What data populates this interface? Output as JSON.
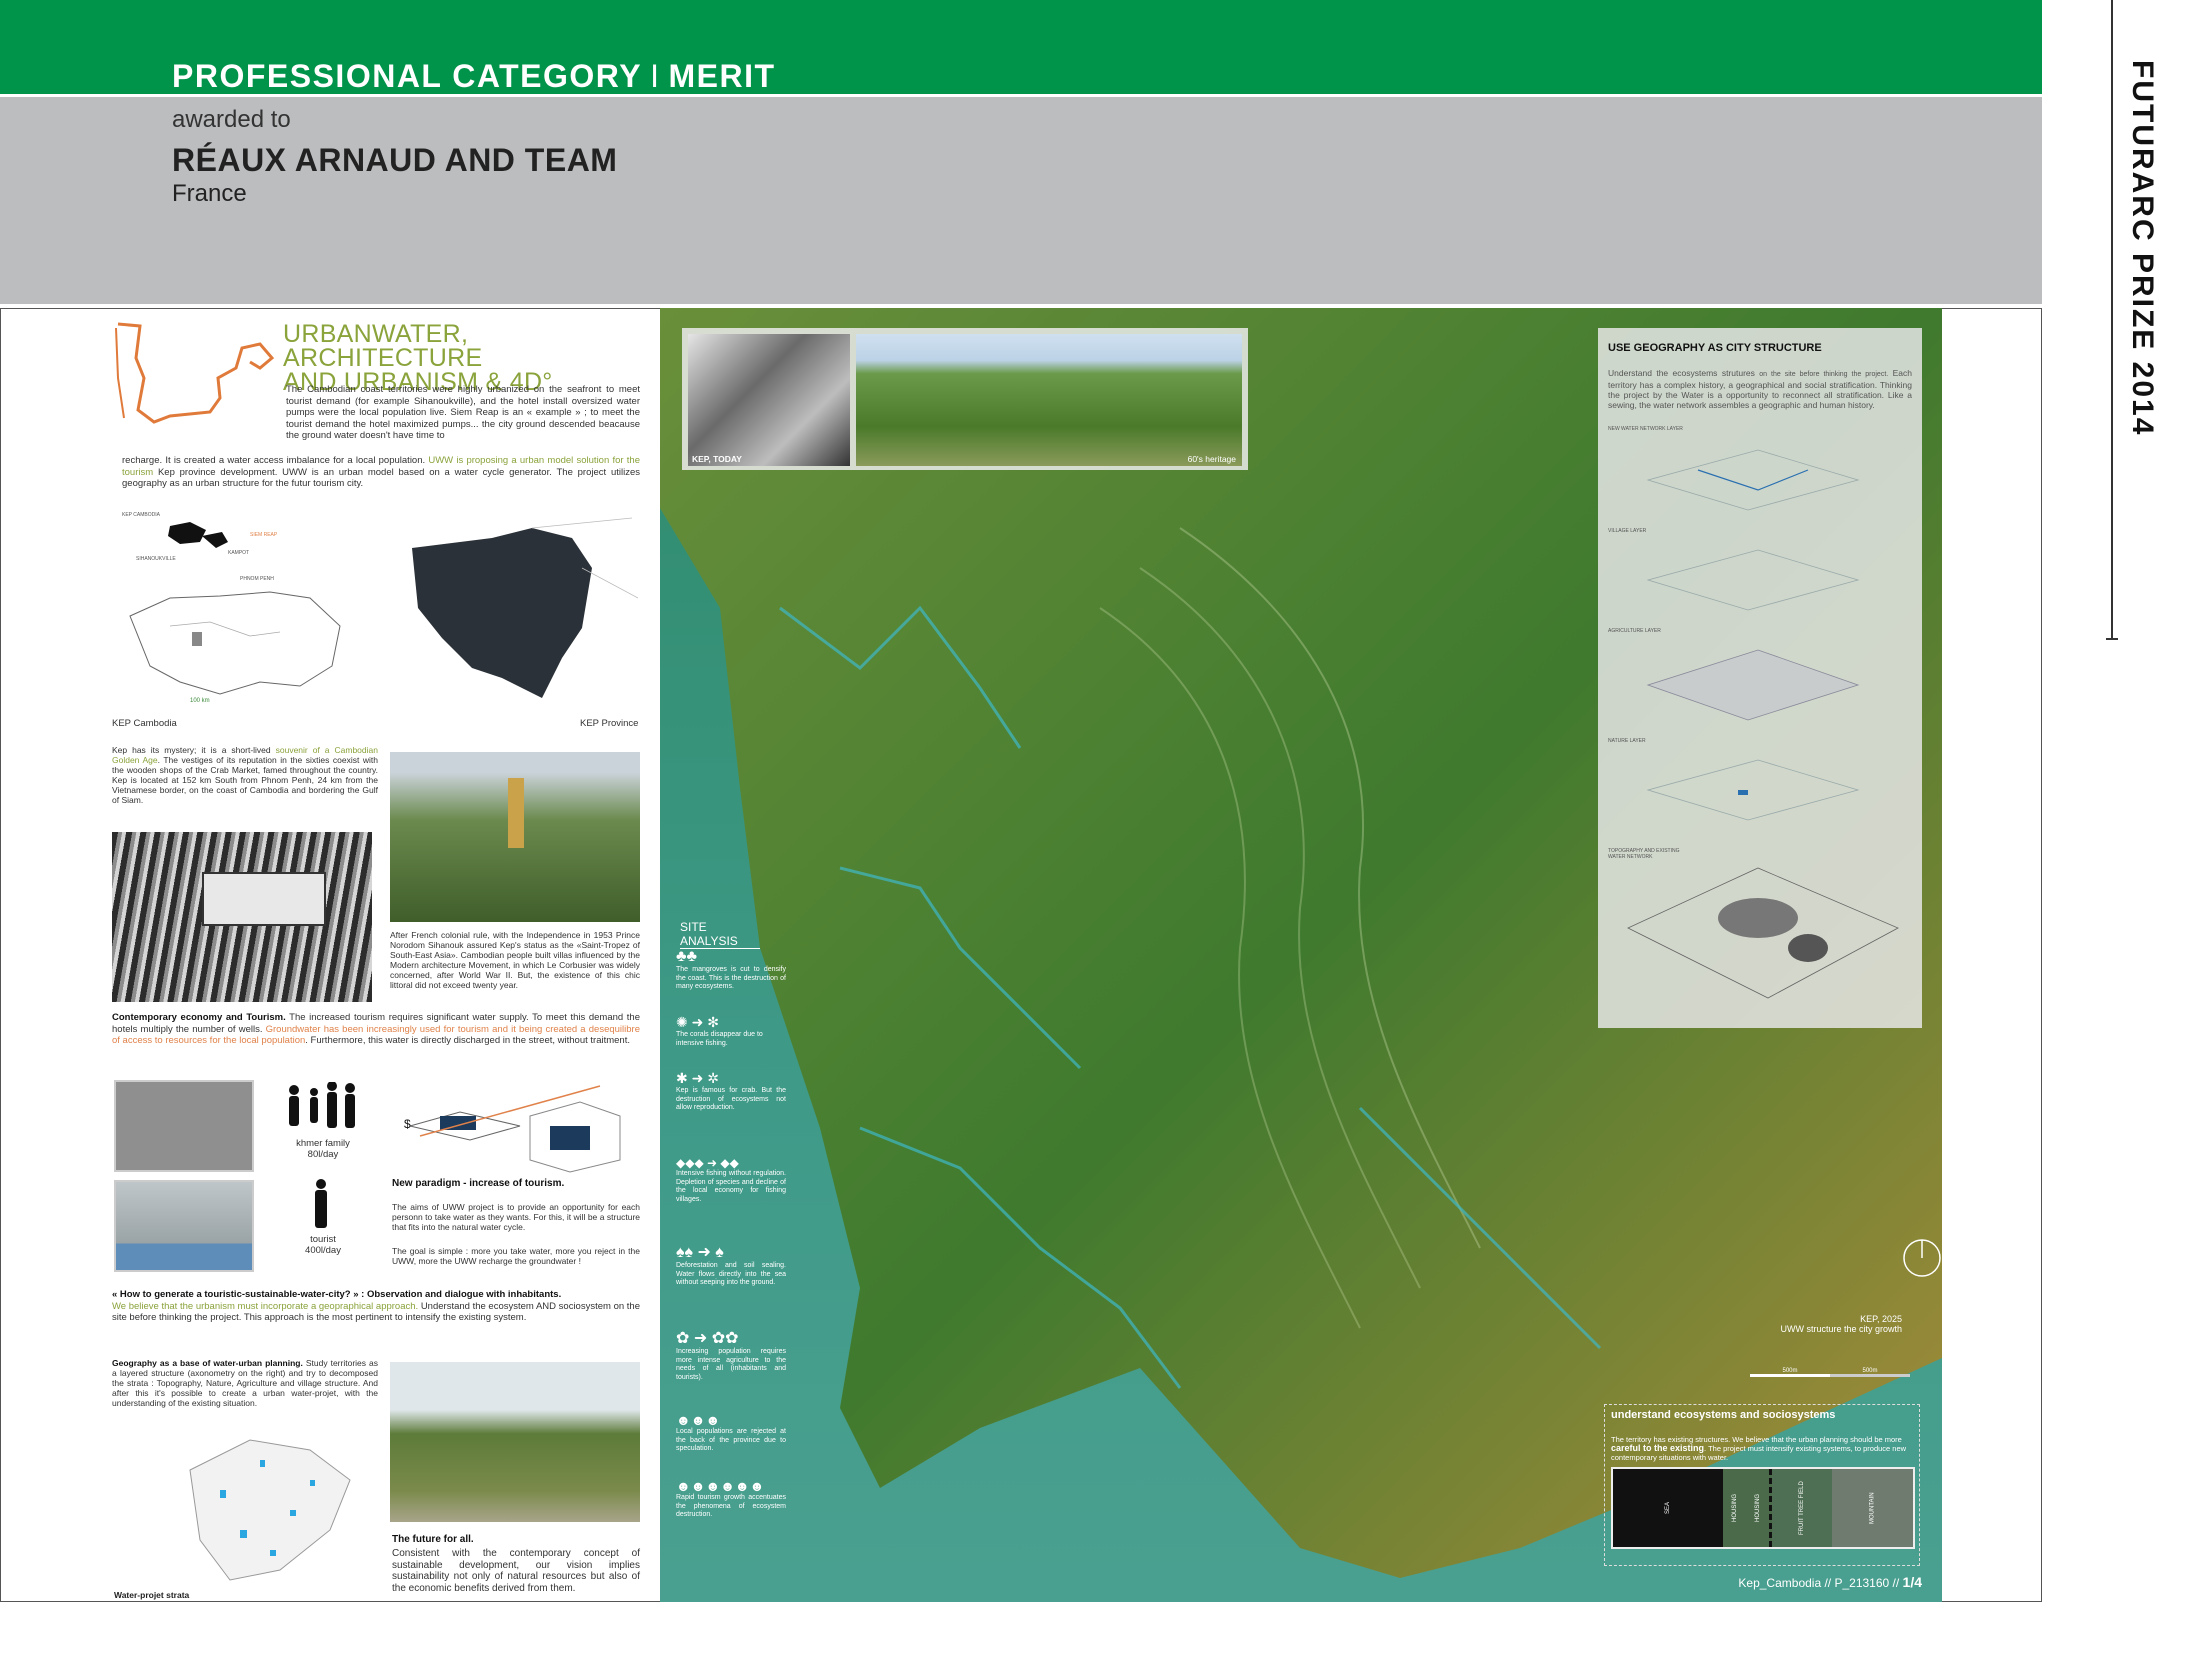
{
  "header": {
    "category": "PROFESSIONAL CATEGORY",
    "separator": "I",
    "award": "MERIT",
    "awarded_to": "awarded to",
    "winner": "RÉAUX ARNAUD AND TEAM",
    "country": "France"
  },
  "side_title": "FUTURARC PRIZE 2014",
  "left": {
    "title_line1": "URBANWATER, ARCHITECTURE",
    "title_line2": "AND URBANISM & 4D°",
    "intro_a": "The Cambodian coast territories were highly urbanized on the seafront to meet tourist demand (for example Sihanoukville), and the hotel install oversized water pumps were the local population live. Siem Reap is an « example » ; to meet the tourist demand the hotel maximized pumps... the city ground descended beacause the ground water doesn't have time to",
    "intro_b": "recharge. It is created a water access imbalance for a local population. ",
    "intro_hl": "UWW is proposing a urban model solution for the tourism",
    "intro_c": " Kep province development. UWW is an urban model  based on a water cycle generator. The project utilizes geography as an urban structure for the futur tourism city.",
    "map_labels": [
      "KEP CAMBODIA",
      "SIHANOUKVILLE",
      "PHNOM PENH",
      "KAMPOT",
      "SIEM REAP"
    ],
    "map_scale": "100 km",
    "caption_cambodia": "KEP Cambodia",
    "caption_province": "KEP Province",
    "mystery_a": "Kep has its mystery; it is a short-lived ",
    "mystery_hl": "souvenir of a Cambodian Golden Age",
    "mystery_b": ". The vestiges of its reputation in the sixties coexist with the wooden shops of the Crab Market, famed throughout the country. Kep is located at 152 km South from Phnom Penh, 24 km from the Vietnamese border, on the coast of Cambodia and bordering the Gulf of Siam.",
    "colonial": "After French colonial rule, with the Independence in 1953 Prince Norodom Sihanouk assured Kep's status as the «Saint-Tropez of South-East Asia». Cambodian people built villas influenced by the Modern architecture Movement, in which Le Corbusier was widely concerned, after World War II. But, the existence of this chic littoral did not exceed twenty year.",
    "economy_bold": "Contemporary economy and Tourism.",
    "economy_a": " The increased tourism requires significant water supply. To meet this demand the hotels multiply the number of wells. ",
    "economy_hl": "Groundwater has been increasingly used for tourism and it being created a desequilibre of access to resources for the local population",
    "economy_b": ". Furthermore, this water is directly discharged in the street, without traitment.",
    "khmer_family": "khmer family",
    "khmer_rate": "80l/day",
    "tourist": "tourist",
    "tourist_rate": "400l/day",
    "paradigm_title": "New paradigm - increase of tourism.",
    "paradigm_a": "The aims of UWW project is to provide an opportunity for each personn to take water as they wants. For this, it will be a structure that fits into the natural water cycle.",
    "paradigm_b": "The goal is simple : more you take water, more you reject in the UWW, more the UWW recharge the groundwater !",
    "howto_bold": "« How to generate a touristic-sustainable-water-city? » : Observation and dialogue with inhabitants.",
    "howto_hl": "We believe that the urbanism must incorporate a geopraphical approach.",
    "howto_b": " Understand the ecosystem AND sociosystem on the site before thinking the project. This approach is the most pertinent to intensify the existing system.",
    "geo_bold": "Geography as a base of water-urban planning.",
    "geo_text": " Study territories as a layered structure (axonometry on the right) and try to decomposed the strata : Topography, Nature, Agriculture and village structure. And after this it's possible to create a urban water-projet, with the understanding of the existing situation.",
    "strata_caption": "Water-projet strata",
    "future_title": "The future for all.",
    "future_text": "Consistent with the contemporary concept of sustainable development, our vision implies sustainability not only of natural resources but also of the economic benefits derived from them."
  },
  "map": {
    "photo_label_left": "KEP, TODAY",
    "photo_label_right": "60's heritage",
    "site_analysis_title": "SITE ANALYSIS",
    "site_items": [
      "The mangroves is cut to densify the coast. This is the destruction of many ecosystems.",
      "The corals disappear due to intensive fishing.",
      "Kep is famous for crab. But the destruction of ecosystems not allow reproduction.",
      "Intensive fishing without regulation. Depletion of species and decline of the local economy for fishing villages.",
      "Deforestation and soil sealing. Water flows directly into the sea without seeping into the ground.",
      "Increasing population requires more intense agriculture to the needs of all (inhabitants and tourists).",
      "Local populations are rejected at the back of the province due to speculation.",
      "Rapid tourism growth accentuates the phenomena of ecosystem destruction."
    ],
    "geo_box_title": "USE GEOGRAPHY AS CITY STRUCTURE",
    "geo_box_a": "Understand the ecosystems strutures ",
    "geo_box_small": "on the site before thinking the project.",
    "geo_box_b": " Each territory has a complex history, a geographical and social stratification. Thinking the project by the Water is a opportunity to reconnect all stratification. Like a sewing, the water network assembles a geographic and human history.",
    "layer_labels": [
      "NEW WATER NETWORK LAYER",
      "VILLAGE LAYER",
      "AGRICULTURE LAYER",
      "NATURE LAYER",
      "TOPOGRAPHY AND EXISTING WATER NETWORK"
    ],
    "kep_label": "KEP, 2025",
    "kep_sub": "UWW structure the city growth",
    "scale_a": "500m",
    "scale_b": "500m",
    "eco_title": "understand ecosystems and sociosystems",
    "eco_a": "The territory has existing structures. We believe that the urban planning should be more ",
    "eco_bold": "careful to the existing",
    "eco_b": ". The project must intensify existing systems, to produce new contemporary situations with water.",
    "strip_labels": [
      "SEA",
      "HOUSING",
      "HOUSING",
      "FRUIT TREE FIELD",
      "MOUNTAIN"
    ],
    "footer_ref": "Kep_Cambodia // P_213160 // ",
    "footer_page": "1/4"
  },
  "colors": {
    "green": "#00934a",
    "gray": "#bcbdbf",
    "accent_green": "#8aa33b",
    "accent_orange": "#e0824a"
  }
}
